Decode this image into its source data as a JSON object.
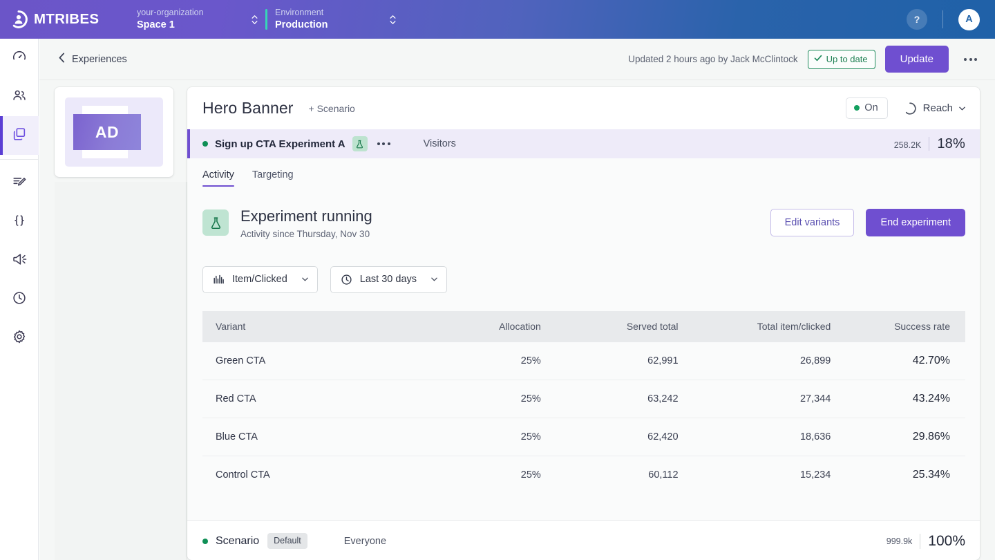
{
  "topbar": {
    "logo_text": "MTRIBES",
    "org": {
      "label": "your-organization",
      "value": "Space 1"
    },
    "environment": {
      "label": "Environment",
      "value": "Production"
    },
    "help_label": "?",
    "avatar_initial": "A"
  },
  "sidebar": {
    "items": [
      {
        "name": "dashboard",
        "icon": "gauge-icon"
      },
      {
        "name": "audience",
        "icon": "people-icon"
      },
      {
        "name": "experiences",
        "icon": "layers-icon",
        "active": true
      },
      {
        "name": "content",
        "icon": "edit-document-icon"
      },
      {
        "name": "developers",
        "icon": "code-braces-icon"
      },
      {
        "name": "announcements",
        "icon": "megaphone-icon"
      },
      {
        "name": "history",
        "icon": "clock-icon"
      },
      {
        "name": "settings",
        "icon": "gear-icon"
      }
    ]
  },
  "subbar": {
    "breadcrumb": "Experiences",
    "updated_text": "Updated 2 hours ago by Jack McClintock",
    "status_badge": "Up to date",
    "update_button": "Update"
  },
  "thumbnail": {
    "label": "AD"
  },
  "experience": {
    "title": "Hero Banner",
    "add_scenario": "+ Scenario",
    "toggle_state": "On",
    "metric_selector": "Reach"
  },
  "experiment_strip": {
    "name": "Sign up CTA Experiment A",
    "audience": "Visitors",
    "count": "258.2K",
    "percent": "18%"
  },
  "tabs": [
    {
      "label": "Activity",
      "active": true
    },
    {
      "label": "Targeting",
      "active": false
    }
  ],
  "status": {
    "title": "Experiment running",
    "subtitle": "Activity since Thursday, Nov 30",
    "edit_variants_button": "Edit variants",
    "end_experiment_button": "End experiment"
  },
  "filters": {
    "metric": "Item/Clicked",
    "period": "Last 30 days"
  },
  "table": {
    "columns": [
      "Variant",
      "Allocation",
      "Served total",
      "Total item/clicked",
      "Success rate"
    ],
    "rows": [
      {
        "variant": "Green CTA",
        "allocation": "25%",
        "served_total": "62,991",
        "total_item_clicked": "26,899",
        "success_rate": "42.70%"
      },
      {
        "variant": "Red CTA",
        "allocation": "25%",
        "served_total": "63,242",
        "total_item_clicked": "27,344",
        "success_rate": "43.24%"
      },
      {
        "variant": "Blue CTA",
        "allocation": "25%",
        "served_total": "62,420",
        "total_item_clicked": "18,636",
        "success_rate": "29.86%"
      },
      {
        "variant": "Control CTA",
        "allocation": "25%",
        "served_total": "60,112",
        "total_item_clicked": "15,234",
        "success_rate": "25.34%"
      }
    ]
  },
  "scenario_row": {
    "label": "Scenario",
    "chip": "Default",
    "audience": "Everyone",
    "count": "999.9k",
    "percent": "100%"
  },
  "colors": {
    "brand_purple": "#6f4fd0",
    "header_gradient_start": "#6b55c8",
    "header_gradient_end": "#1f61a8",
    "accent_teal": "#37d6b7",
    "status_green": "#1d7f52",
    "active_dot_green": "#0f8f56"
  }
}
